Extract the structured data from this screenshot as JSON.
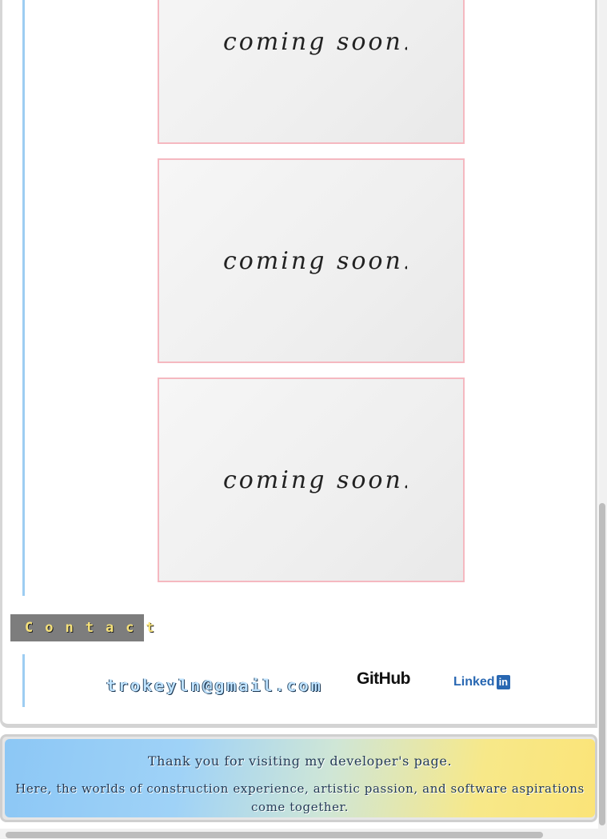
{
  "projects": {
    "cards": [
      {
        "text": "coming soon..."
      },
      {
        "text": "coming soon..."
      },
      {
        "text": "coming soon..."
      }
    ]
  },
  "contact": {
    "heading": "Contact",
    "email": "trokeyln@gmail.com",
    "github_label": "GitHub",
    "linkedin_word": "Linked",
    "linkedin_box": "in"
  },
  "footer": {
    "line1": "Thank you for visiting my developer's page.",
    "line2": "Here, the worlds of construction experience, artistic passion, and software aspirations come together."
  },
  "colors": {
    "accent_line": "#9dcdf2",
    "card_border": "#f5b8c0",
    "contact_bg": "#7d7d7d",
    "contact_text": "#f6e27a",
    "linkedin_blue": "#2867b2"
  }
}
